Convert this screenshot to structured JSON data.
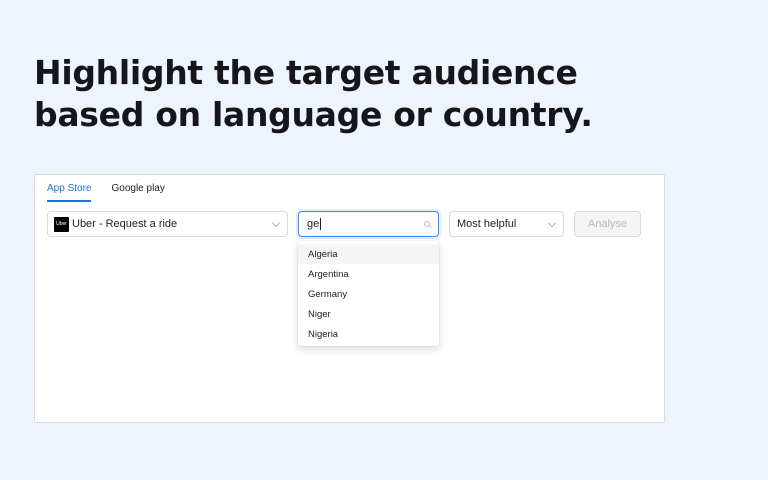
{
  "headline": {
    "line1": "Highlight the target audience",
    "line2": "based on language or country."
  },
  "tabs": [
    {
      "label": "App Store",
      "active": true
    },
    {
      "label": "Google play",
      "active": false
    }
  ],
  "app_select": {
    "logo_text": "Uber",
    "value": "Uber - Request a ride"
  },
  "country_search": {
    "value": "ge"
  },
  "country_options": [
    "Algeria",
    "Argentina",
    "Germany",
    "Niger",
    "Nigeria"
  ],
  "sort_select": {
    "value": "Most helpful"
  },
  "analyse_button": {
    "label": "Analyse"
  },
  "colors": {
    "accent": "#1a73d9",
    "background": "#eef4fc"
  }
}
